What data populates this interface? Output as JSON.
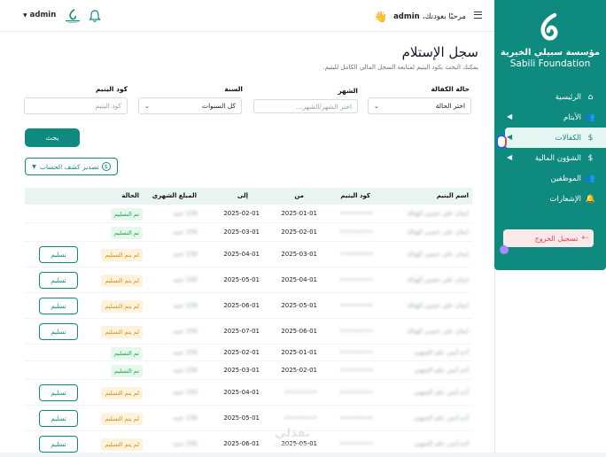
{
  "topbar": {
    "greeting_prefix": "مرحبًا بعودتك،",
    "user_in_greeting": "admin",
    "wave": "👋",
    "user_menu": "admin"
  },
  "sidebar": {
    "org_name_ar": "مؤسسة سبيلي الخيرية",
    "org_name_en": "Sabili Foundation",
    "items": [
      {
        "label": "الرئيسية",
        "icon": "home-icon",
        "chevron": false,
        "active": false
      },
      {
        "label": "الأيتام",
        "icon": "users-icon",
        "chevron": true,
        "active": false
      },
      {
        "label": "الكفالات",
        "icon": "coin-icon",
        "chevron": true,
        "active": true
      },
      {
        "label": "الشؤون المالية",
        "icon": "money-bag-icon",
        "chevron": true,
        "active": false
      },
      {
        "label": "الموظفين",
        "icon": "users-icon",
        "chevron": false,
        "active": false
      },
      {
        "label": "الإشعارات",
        "icon": "bell-icon",
        "chevron": false,
        "active": false
      }
    ],
    "logout_label": "تسجيل الخروج"
  },
  "page": {
    "title": "سجل الإستلام",
    "subtitle": "يمكنك البحث بكود اليتيم لمتابعة السجل المالي الكامل لليتيم."
  },
  "filters": {
    "status_label": "حالة الكفالة",
    "status_value": "اختر الحالة",
    "month_label": "الشهر",
    "month_placeholder": "اختر الشهر/الشهر...",
    "year_label": "السنة",
    "year_value": "كل السنوات",
    "code_label": "كود اليتيم",
    "code_placeholder": "كود اليتيم",
    "search_button": "بحث",
    "export_button": "تصدير كشف الحساب"
  },
  "table": {
    "headers": [
      "اسم اليتيم",
      "كود اليتيم",
      "من",
      "إلى",
      "المبلغ الشهري",
      "الحالة"
    ],
    "deliver_label": "تسليم",
    "rows": [
      {
        "name": "ايمان علي حسين الهبالة",
        "code": "•••••••••",
        "from": "2025-01-01",
        "to": "2025-02-01",
        "amount": "150 جنيه",
        "status": "تم التسليم",
        "delivered": true
      },
      {
        "name": "ايمان علي حسين الهبالة",
        "code": "•••••••••",
        "from": "2025-02-01",
        "to": "2025-03-01",
        "amount": "150 جنيه",
        "status": "تم التسليم",
        "delivered": true
      },
      {
        "name": "ايمان علي حسين الهبالة",
        "code": "•••••••••",
        "from": "2025-03-01",
        "to": "2025-04-01",
        "amount": "150 جنيه",
        "status": "لم يتم التسليم",
        "delivered": false
      },
      {
        "name": "ايمان علي حسين الهبالة",
        "code": "•••••••••",
        "from": "2025-04-01",
        "to": "2025-05-01",
        "amount": "150 جنيه",
        "status": "لم يتم التسليم",
        "delivered": false
      },
      {
        "name": "ايمان علي حسين الهبالة",
        "code": "•••••••••",
        "from": "2025-05-01",
        "to": "2025-06-01",
        "amount": "150 جنيه",
        "status": "لم يتم التسليم",
        "delivered": false
      },
      {
        "name": "ايمان علي حسين الهبالة",
        "code": "•••••••••",
        "from": "2025-06-01",
        "to": "2025-07-01",
        "amount": "150 جنيه",
        "status": "لم يتم التسليم",
        "delivered": false
      },
      {
        "name": "آدم أيمن علم السهبي",
        "code": "•••••••••",
        "from": "2025-01-01",
        "to": "2025-02-01",
        "amount": "150 جنيه",
        "status": "تم التسليم",
        "delivered": true
      },
      {
        "name": "آدم أيمن علم السهبي",
        "code": "•••••••••",
        "from": "2025-02-01",
        "to": "2025-03-01",
        "amount": "150 جنيه",
        "status": "تم التسليم",
        "delivered": true
      },
      {
        "name": "آدم أيمن علم السهبي",
        "code": "•••••••••",
        "from": "•••••••••",
        "to": "2025-04-01",
        "amount": "150 جنيه",
        "status": "لم يتم التسليم",
        "delivered": false
      },
      {
        "name": "آدم أيمن علم السهبي",
        "code": "•••••••••",
        "from": "•••••••••",
        "to": "2025-05-01",
        "amount": "150 جنيه",
        "status": "لم يتم التسليم",
        "delivered": false
      },
      {
        "name": "آدم أيمن علم السهبي",
        "code": "•••••••••",
        "from": "2025-05-01",
        "to": "2025-06-01",
        "amount": "150 جنيه",
        "status": "لم يتم التسليم",
        "delivered": false
      }
    ]
  },
  "watermark": {
    "text": "نفذلي",
    "sub": "nafezly.com"
  },
  "colors": {
    "brand": "#0f8a7f",
    "delivered": "#16a34a",
    "pending": "#e8890c",
    "logout": "#d9485a"
  }
}
